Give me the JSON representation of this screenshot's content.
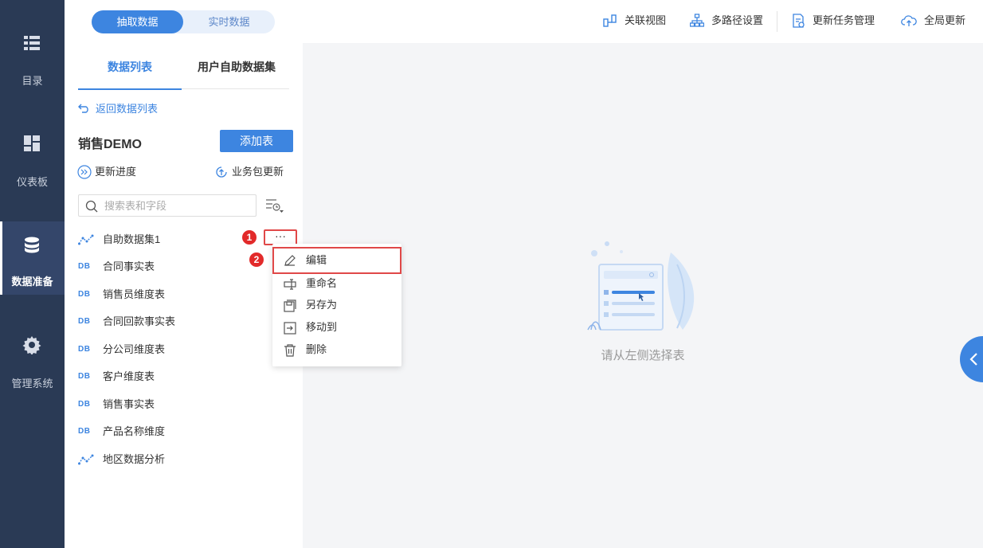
{
  "nav": [
    {
      "label": "目录",
      "icon": "list-icon"
    },
    {
      "label": "仪表板",
      "icon": "dashboard-icon"
    },
    {
      "label": "数据准备",
      "icon": "database-icon",
      "active": true
    },
    {
      "label": "管理系统",
      "icon": "gear-icon"
    }
  ],
  "topbar": {
    "mode_extract": "抽取数据",
    "mode_realtime": "实时数据",
    "relation_view": "关联视图",
    "multipath": "多路径设置",
    "update_task": "更新任务管理",
    "global_update": "全局更新"
  },
  "panel": {
    "tab_data_list": "数据列表",
    "tab_self_service": "用户自助数据集",
    "back": "返回数据列表",
    "package_title": "销售DEMO",
    "add_table": "添加表",
    "update_progress": "更新进度",
    "package_update": "业务包更新",
    "search_placeholder": "搜索表和字段",
    "items": [
      {
        "name": "自助数据集1",
        "type": "dataset"
      },
      {
        "name": "合同事实表",
        "type": "DB"
      },
      {
        "name": "销售员维度表",
        "type": "DB"
      },
      {
        "name": "合同回款事实表",
        "type": "DB"
      },
      {
        "name": "分公司维度表",
        "type": "DB"
      },
      {
        "name": "客户维度表",
        "type": "DB"
      },
      {
        "name": "销售事实表",
        "type": "DB"
      },
      {
        "name": "产品名称维度",
        "type": "DB"
      },
      {
        "name": "地区数据分析",
        "type": "dataset"
      }
    ],
    "db_tag": "DB",
    "more": "···"
  },
  "markers": {
    "one": "1",
    "two": "2"
  },
  "menu": {
    "edit": "编辑",
    "rename": "重命名",
    "save_as": "另存为",
    "move_to": "移动到",
    "delete": "删除"
  },
  "main": {
    "empty_text": "请从左侧选择表"
  },
  "colors": {
    "primary": "#3d85e0",
    "nav_bg": "#2a3a55",
    "highlight": "#e04848"
  }
}
